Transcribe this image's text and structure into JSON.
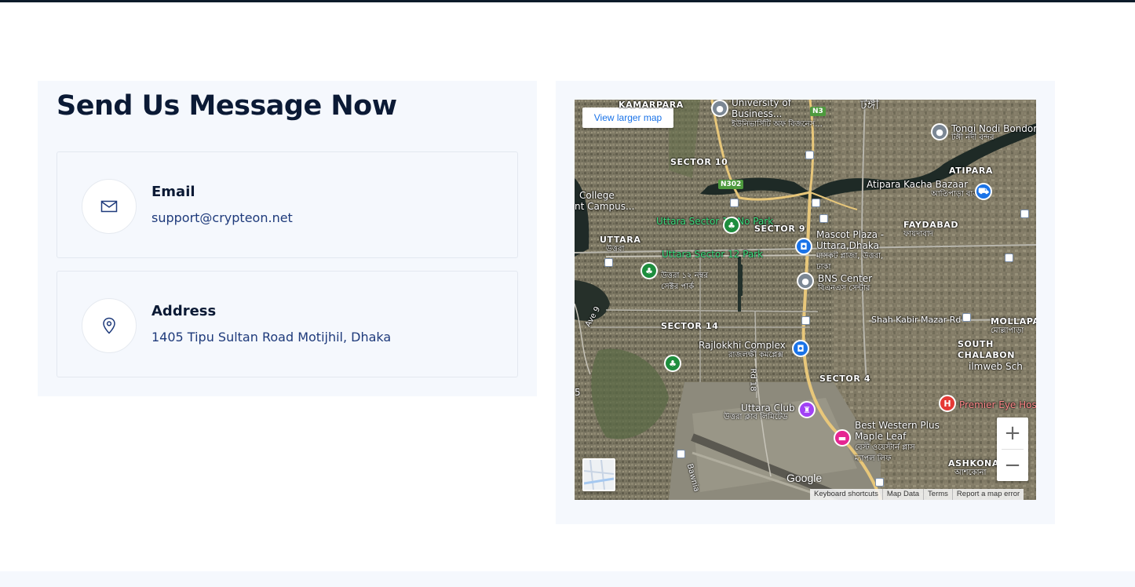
{
  "contact": {
    "title": "Send Us Message Now",
    "email": {
      "label": "Email",
      "value": "support@crypteon.net",
      "icon": "mail-icon"
    },
    "address": {
      "label": "Address",
      "value": "1405 Tipu Sultan Road Motijhil, Dhaka",
      "icon": "location-pin-icon"
    }
  },
  "map": {
    "view_larger": "View larger map",
    "zoom_in": "+",
    "zoom_out": "−",
    "google": "Google",
    "attribution": [
      "Keyboard shortcuts",
      "Map Data",
      "Terms",
      "Report a map error"
    ],
    "labels": {
      "kamarpara": "KAMARPARA",
      "university": "University of Business...",
      "university_bn": "ইউনিভার্সিটি অফ বিজনেস...",
      "tongi": "টঙ্গী",
      "tongi_nodi": "Tongi Nodi Bondor",
      "tongi_nodi_bn": "টঙ্গী নদী বন্দর",
      "atipara": "ATIPARA",
      "sector10": "SECTOR 10",
      "college": "College",
      "campus": "nt Campus...",
      "atipara_bazaar": "Atipara Kacha Bazaar",
      "atipara_bazaar_bn": "আতিপাড়া বাজার",
      "faydabad": "FAYDABAD",
      "faydabad_bn": "ফায়দাবাদ",
      "uttara": "UTTARA",
      "uttara_bn": "উত্তরা",
      "park11": "Uttara Sector 11 No Park",
      "sector9": "SECTOR 9",
      "mascot": "Mascot Plaza - Uttara,Dhaka",
      "mascot_bn": "মাসকট প্লাজা, উত্তরা, ঢাকা",
      "park12": "Uttara Sector 12 Park",
      "park12_bn": "উত্তরা ১২ নম্বর সেক্টর পার্ক",
      "bns": "BNS Center",
      "bns_bn": "বিএনএস সেন্টার",
      "sector14": "SECTOR 14",
      "shah_kabir": "Shah Kabir Mazar Rd",
      "mollapara": "MOLLAPARA",
      "mollapara_bn": "মোল্লাপাড়া",
      "rajlokkhi": "Rajlokkhi Complex",
      "rajlokkhi_bn": "রাজলক্ষী কমপ্লেক্স",
      "south_chalabon": "SOUTH CHALABON",
      "ilmweb": "ilmweb Sch",
      "sector4": "SECTOR 4",
      "rd18": "Rd 18",
      "ave9": "Ave 9",
      "uttara_club": "Uttara Club",
      "uttara_club_bn": "উত্তরা ক্লাব লিমিটেড",
      "premier": "Premier Eye Hos",
      "best_western": "Best Western Plus Maple Leaf",
      "best_western_bn": "বেস্ট ওয়েস্টার্ন প্লাস ম্যাপল লিফ",
      "ashkona": "ASHKONA",
      "ashkona_bn": "আশকোনা",
      "bawnia": "Bawnia",
      "n3": "N3",
      "n302": "N302",
      "hospital_letter": "H",
      "five": "5"
    }
  }
}
